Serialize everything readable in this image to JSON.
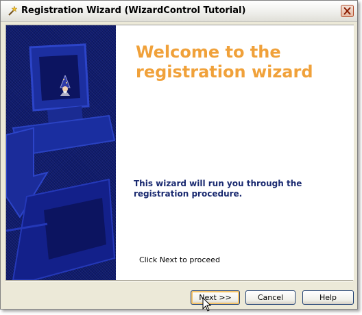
{
  "window": {
    "title": "Registration Wizard (WizardControl Tutorial)",
    "icon": "wizard-wand-icon",
    "close_icon": "close-icon"
  },
  "banner": {
    "background_color": "#0f1b6e",
    "art": "computer-and-arrow-graphic",
    "icon": "wizard-icon"
  },
  "page": {
    "title": "Welcome to the registration wizard",
    "title_color": "#f0a13a",
    "intro": "This wizard will run you through the registration procedure.",
    "intro_color": "#1a2a70",
    "hint": "Click Next to proceed"
  },
  "buttons": {
    "next": "Next >>",
    "cancel": "Cancel",
    "help": "Help"
  }
}
